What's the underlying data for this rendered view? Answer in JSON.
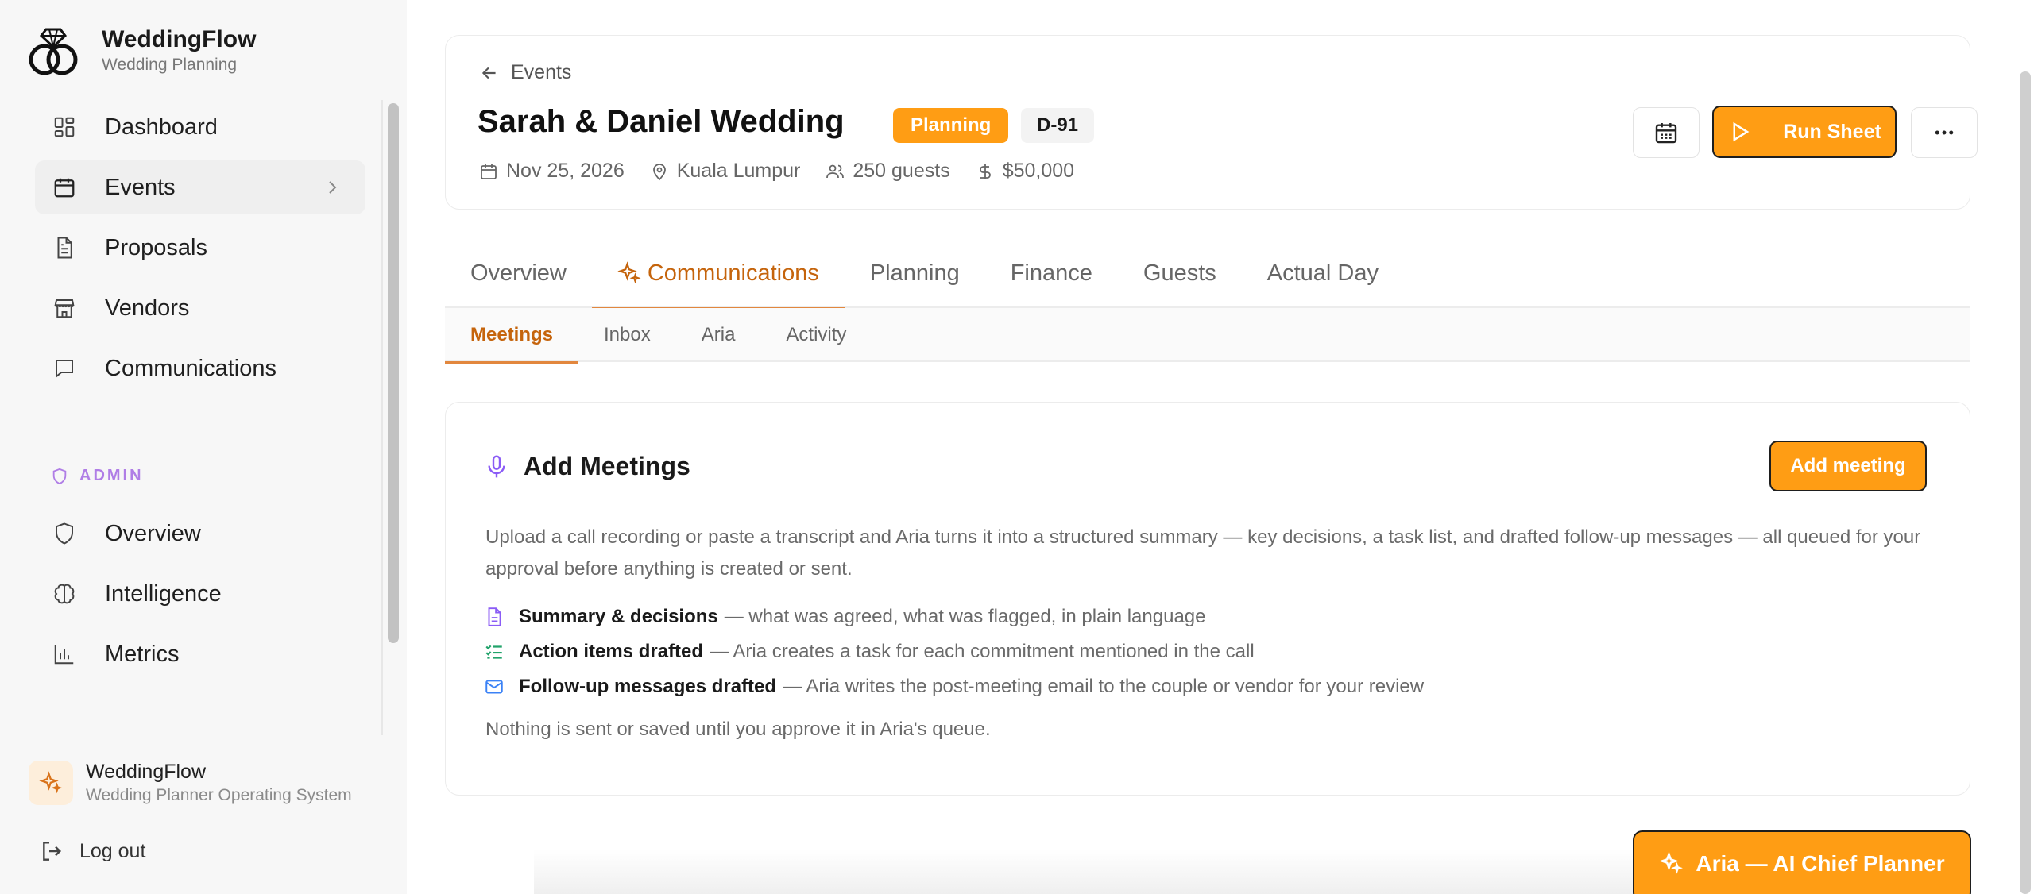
{
  "brand": {
    "title": "WeddingFlow",
    "subtitle": "Wedding Planning"
  },
  "nav": [
    {
      "label": "Dashboard",
      "icon": "dashboard-icon"
    },
    {
      "label": "Events",
      "icon": "calendar-icon",
      "active": true
    },
    {
      "label": "Proposals",
      "icon": "document-icon"
    },
    {
      "label": "Vendors",
      "icon": "store-icon"
    },
    {
      "label": "Communications",
      "icon": "chat-icon"
    }
  ],
  "admin": {
    "label": "ADMIN",
    "items": [
      {
        "label": "Overview",
        "icon": "shield-icon"
      },
      {
        "label": "Intelligence",
        "icon": "brain-icon"
      },
      {
        "label": "Metrics",
        "icon": "bar-chart-icon"
      }
    ]
  },
  "footer": {
    "title": "WeddingFlow",
    "subtitle": "Wedding Planner Operating System",
    "logout": "Log out"
  },
  "event": {
    "back": "Events",
    "title": "Sarah & Daniel Wedding",
    "status": "Planning",
    "countdown": "D-91",
    "date": "Nov 25, 2026",
    "location": "Kuala Lumpur",
    "guests": "250 guests",
    "budget": "$50,000",
    "run_sheet": "Run Sheet"
  },
  "tabs": [
    "Overview",
    "Communications",
    "Planning",
    "Finance",
    "Guests",
    "Actual Day"
  ],
  "subtabs": [
    "Meetings",
    "Inbox",
    "Aria",
    "Activity"
  ],
  "meetings": {
    "title": "Add Meetings",
    "add_button": "Add meeting",
    "description": "Upload a call recording or paste a transcript and Aria turns it into a structured summary — key decisions, a task list, and drafted follow-up messages — all queued for your approval before anything is created or sent.",
    "features": [
      {
        "title": "Summary & decisions",
        "desc": "— what was agreed, what was flagged, in plain language"
      },
      {
        "title": "Action items drafted",
        "desc": "— Aria creates a task for each commitment mentioned in the call"
      },
      {
        "title": "Follow-up messages drafted",
        "desc": "— Aria writes the post-meeting email to the couple or vendor for your review"
      }
    ],
    "note": "Nothing is sent or saved until you approve it in Aria's queue."
  },
  "aria": {
    "label": "Aria — AI Chief Planner"
  },
  "colors": {
    "accent": "#ff9d14",
    "accent_text": "#c5640c",
    "admin": "#b07ee6"
  }
}
